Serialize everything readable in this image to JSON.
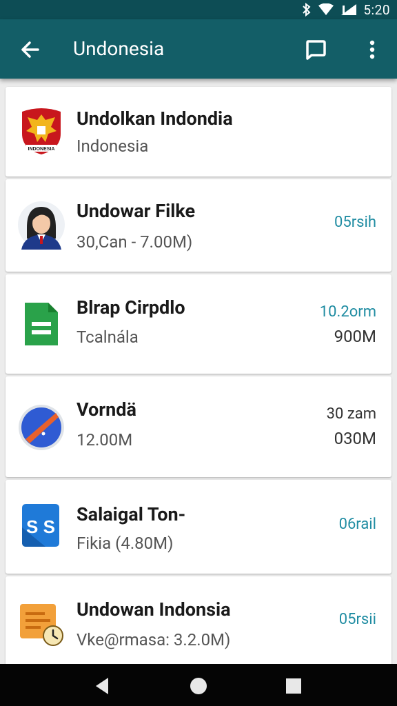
{
  "status_bar": {
    "time": "5:20"
  },
  "app_bar": {
    "title": "Undonesia"
  },
  "items": [
    {
      "name": "Undolkan Indondia",
      "subtitle": "Indonesia",
      "meta1": "",
      "meta2": "",
      "emblem_text": "INDONESIA"
    },
    {
      "name": "Undowar Filke",
      "subtitle": "30,Can - 7.00M)",
      "meta1": "05rsih",
      "meta2": ""
    },
    {
      "name": "Blrap Cirpdlo",
      "subtitle": "Tcalnála",
      "meta1": "10.2orm",
      "meta2": "900M"
    },
    {
      "name": "Vorndä",
      "subtitle": "12.00M",
      "meta1": "30 zam",
      "meta2": "030M"
    },
    {
      "name": "Salaigal Ton-",
      "subtitle": "Fikia  (4.80M)",
      "meta1": "06rail",
      "meta2": "",
      "icon_text": "S S"
    },
    {
      "name": "Undowan Indonsia",
      "subtitle": "Vke@rmasa: 3.2.0M)",
      "meta1": "05rsii",
      "meta2": ""
    }
  ],
  "colors": {
    "app_bar": "#135e67",
    "status_bar": "#0d4d55",
    "accent": "#1f8ca2"
  }
}
